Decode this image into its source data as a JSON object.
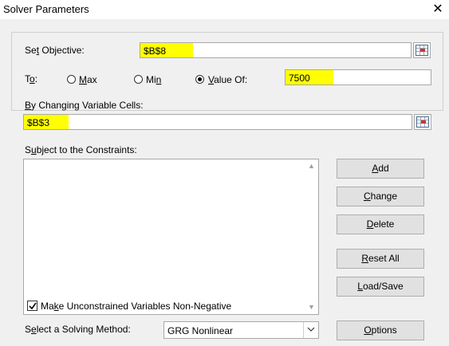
{
  "window": {
    "title": "Solver Parameters",
    "close_glyph": "✕"
  },
  "objective": {
    "label_pre": "Se",
    "label_key": "t",
    "label_post": " Objective:",
    "value": "$B$8",
    "highlight_color": "#ffff00"
  },
  "to": {
    "label_pre": "T",
    "label_key": "o",
    "label_post": ":",
    "options": [
      {
        "key": "M",
        "rest": "ax",
        "checked": false
      },
      {
        "key": "",
        "pre": "Mi",
        "keych": "n",
        "rest": "",
        "checked": false
      },
      {
        "key": "V",
        "rest": "alue Of:",
        "checked": true
      }
    ],
    "value_of": "7500"
  },
  "changing": {
    "label_key": "B",
    "label_post": "y Changing Variable Cells:",
    "value": "$B$3"
  },
  "constraints": {
    "label_pre": "S",
    "label_key": "u",
    "label_post": "bject to the Constraints:",
    "items": []
  },
  "buttons": {
    "add": {
      "key": "A",
      "rest": "dd"
    },
    "change": {
      "key": "C",
      "rest": "hange"
    },
    "delete": {
      "key": "D",
      "rest": "elete"
    },
    "reset": {
      "key": "R",
      "rest": "eset All"
    },
    "load_save": {
      "key": "L",
      "rest": "oad/Save"
    },
    "options": {
      "key": "O",
      "rest": "ptions"
    }
  },
  "nonneg": {
    "checked": true,
    "label_pre": "Ma",
    "label_key": "k",
    "label_post": "e Unconstrained Variables Non-Negative"
  },
  "method": {
    "label_pre": "S",
    "label_key": "e",
    "label_post": "lect a Solving Method:",
    "value": "GRG Nonlinear"
  },
  "icons": {
    "refedit": "range-selector-icon",
    "checkmark": "checkmark-icon",
    "dropdown": "chevron-down-icon"
  }
}
